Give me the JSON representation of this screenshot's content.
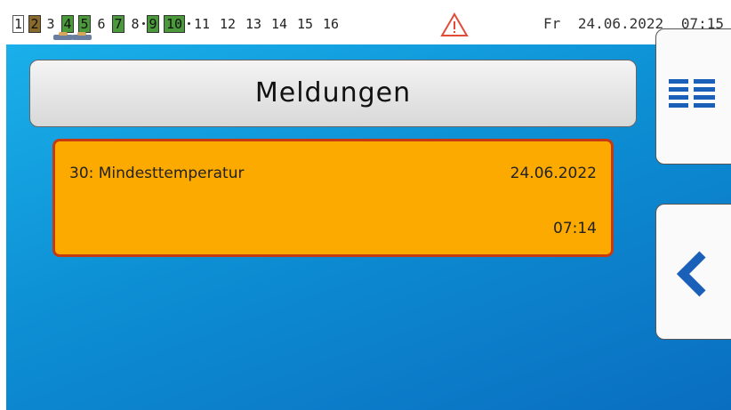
{
  "status_bar": {
    "outputs": [
      "1",
      "2",
      "3",
      "4",
      "5",
      "6",
      "7",
      "8",
      "9",
      "10",
      "11",
      "12",
      "13",
      "14",
      "15",
      "16"
    ],
    "datetime": {
      "day": "Fr",
      "date": "24.06.2022",
      "time": "07:15"
    },
    "icons": [
      "manual-hand-icon",
      "warning-triangle-icon"
    ],
    "colors": {
      "active_output": "#4a9a3c",
      "manual_output": "#8a6a2a",
      "warning": "#e04b3a"
    }
  },
  "page": {
    "title": "Meldungen"
  },
  "messages": [
    {
      "name": "30: Mindesttemperatur",
      "date": "24.06.2022",
      "time": "07:14"
    }
  ],
  "side_buttons": {
    "icons": [
      "list-view-icon",
      "back-chevron-icon"
    ]
  },
  "colors": {
    "background": "#0d8fd4",
    "message_fill": "#fdaa00",
    "message_border": "#c63a12",
    "icon_blue": "#1a5fb8"
  }
}
